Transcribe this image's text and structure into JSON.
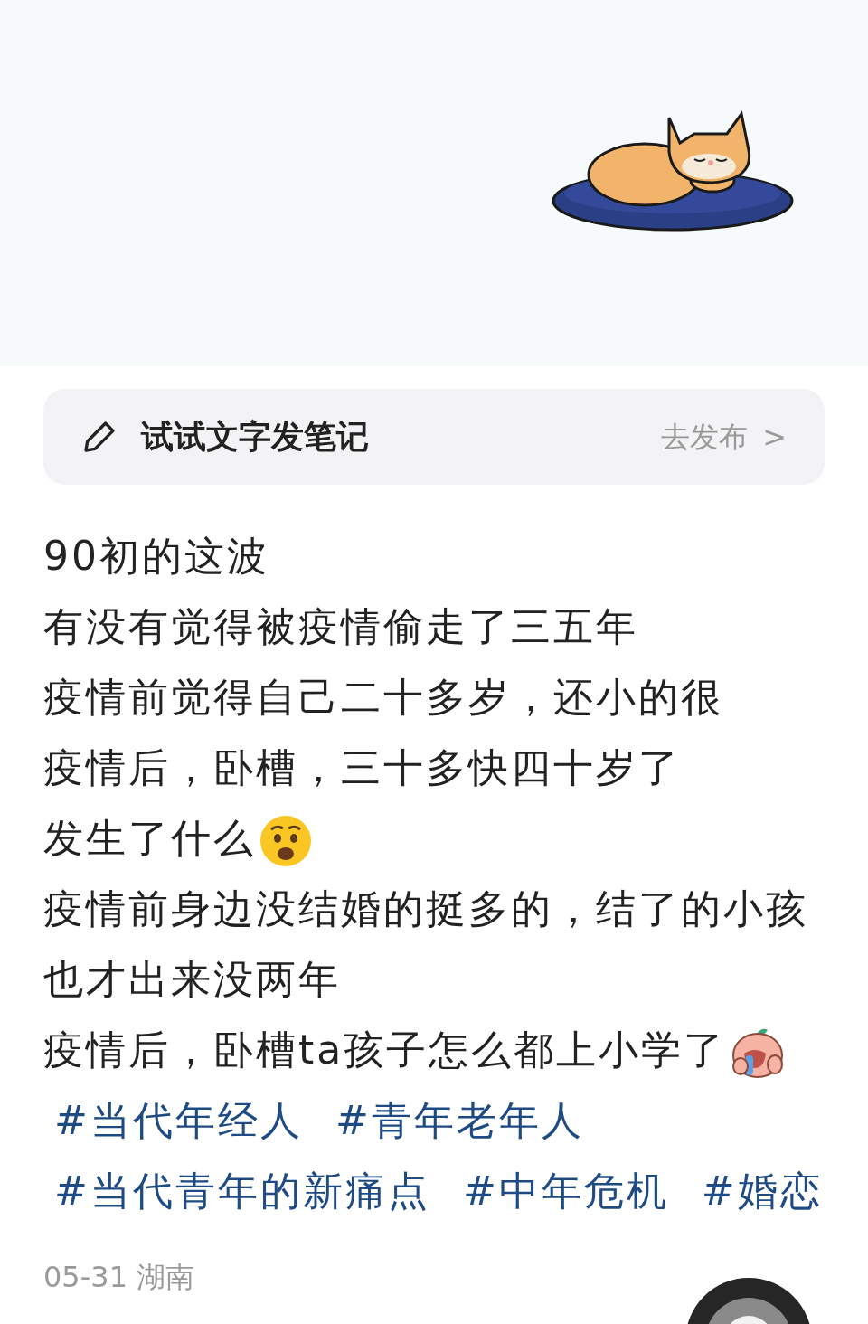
{
  "compose_bar": {
    "label": "试试文字发笔记",
    "action": "去发布",
    "chevron": ">"
  },
  "post": {
    "lines": [
      {
        "text": "90初的这波",
        "kind": "plain"
      },
      {
        "text": "有没有觉得被疫情偷走了三五年",
        "kind": "plain"
      },
      {
        "text": "疫情前觉得自己二十多岁，还小的很",
        "kind": "plain"
      },
      {
        "text": "疫情后，卧槽，三十多快四十岁了",
        "kind": "plain"
      },
      {
        "text": "发生了什么",
        "kind": "shocked"
      },
      {
        "text": "疫情前身边没结婚的挺多的，结了的小孩也才出来没两年",
        "kind": "plain"
      },
      {
        "text": "疫情后，卧槽ta孩子怎么都上小学了",
        "kind": "crying"
      }
    ],
    "tags": [
      "#当代年经人",
      "#青年老年人",
      "#当代青年的新痛点",
      "#中年危机",
      "#婚恋"
    ],
    "meta": "05-31 湖南"
  }
}
